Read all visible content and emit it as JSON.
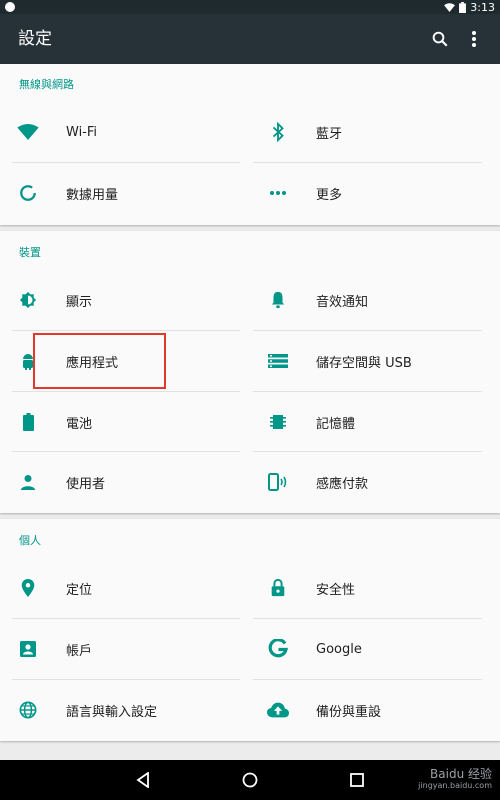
{
  "status_bar": {
    "time": "3:13"
  },
  "app_bar": {
    "title": "設定"
  },
  "sections": {
    "wireless": {
      "header": "無線與網路",
      "wifi": "Wi-Fi",
      "bluetooth": "藍牙",
      "data_usage": "數據用量",
      "more": "更多"
    },
    "device": {
      "header": "裝置",
      "display": "顯示",
      "sound": "音效通知",
      "apps": "應用程式",
      "storage": "儲存空間與 USB",
      "battery": "電池",
      "memory": "記憶體",
      "users": "使用者",
      "tap_pay": "感應付款"
    },
    "personal": {
      "header": "個人",
      "location": "定位",
      "security": "安全性",
      "accounts": "帳戶",
      "google": "Google",
      "language": "語言與輸入設定",
      "backup": "備份與重設"
    }
  },
  "watermark": {
    "main": "Baidu 经验",
    "sub": "jingyan.baidu.com"
  },
  "colors": {
    "accent": "#009688",
    "app_bar": "#263238",
    "highlight": "#e03a2f"
  }
}
